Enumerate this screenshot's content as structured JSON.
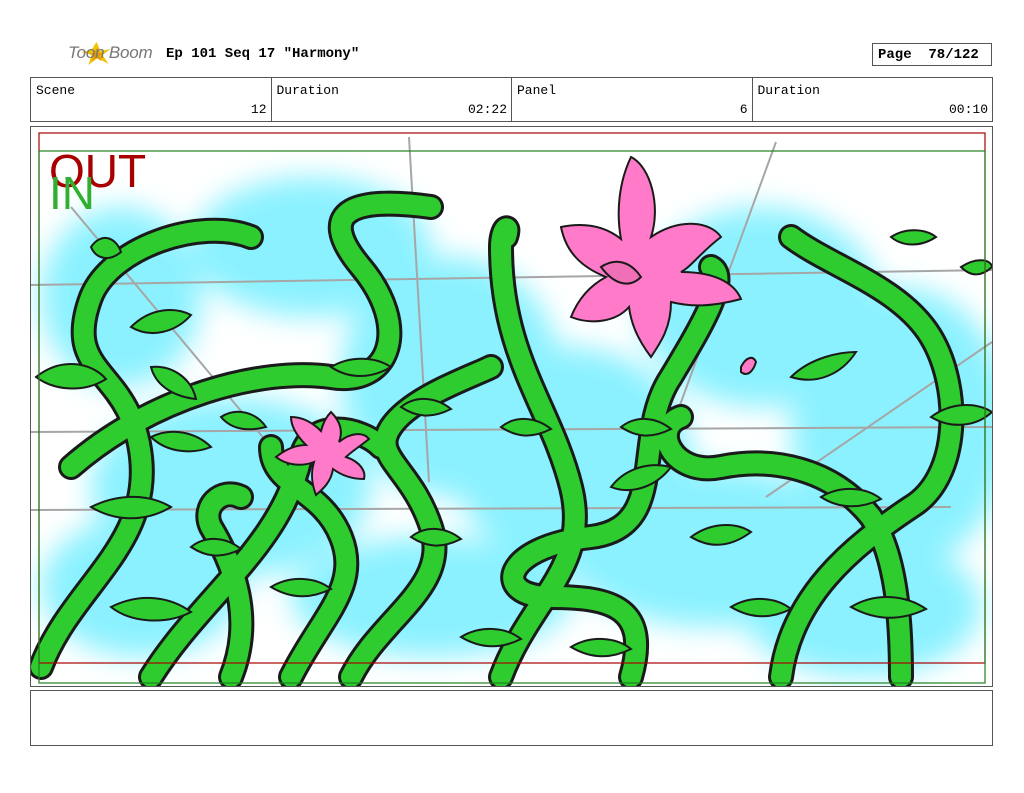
{
  "header": {
    "logo_text": "Toon Boom",
    "title": "Ep 101 Seq 17 \"Harmony\"",
    "page": "Page  78/122"
  },
  "info": [
    {
      "label": "Scene",
      "value": "12"
    },
    {
      "label": "Duration",
      "value": "02:22"
    },
    {
      "label": "Panel",
      "value": "6"
    },
    {
      "label": "Duration",
      "value": "00:10"
    }
  ],
  "panel": {
    "out_label": "OUT",
    "in_label": "IN"
  },
  "notes": ""
}
